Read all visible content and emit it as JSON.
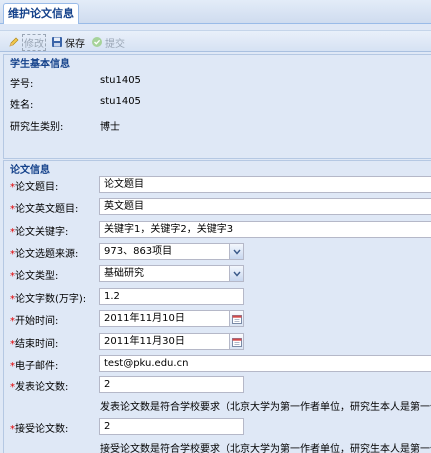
{
  "tab": {
    "label": "维护论文信息"
  },
  "toolbar": {
    "edit_label": "修改",
    "save_label": "保存",
    "submit_label": "提交"
  },
  "basic": {
    "legend": "学生基本信息",
    "student_id_label": "学号:",
    "student_id": "stu1405",
    "name_label": "姓名:",
    "name": "stu1405",
    "category_label": "研究生类别:",
    "category": "博士"
  },
  "paper": {
    "legend": "论文信息",
    "title_label": "论文题目:",
    "title": "论文题目",
    "en_title_label": "论文英文题目:",
    "en_title": "英文题目",
    "keywords_label": "论文关键字:",
    "keywords": "关键字1，关键字2，关键字3",
    "source_label": "论文选题来源:",
    "source": "973、863项目",
    "type_label": "论文类型:",
    "type": "基础研究",
    "words_label": "论文字数(万字):",
    "words": "1.2",
    "start_label": "开始时间:",
    "start": "2011年11月10日",
    "end_label": "结束时间:",
    "end": "2011年11月30日",
    "email_label": "电子邮件:",
    "email": "test@pku.edu.cn",
    "published_label": "发表论文数:",
    "published": "2",
    "published_note": "发表论文数是符合学校要求（北京大学为第一作者单位，研究生本人是第一作",
    "accepted_label": "接受论文数:",
    "accepted": "2",
    "accepted_note": "接受论文数是符合学校要求（北京大学为第一作者单位，研究生本人是第一作"
  },
  "required_mark": "*"
}
